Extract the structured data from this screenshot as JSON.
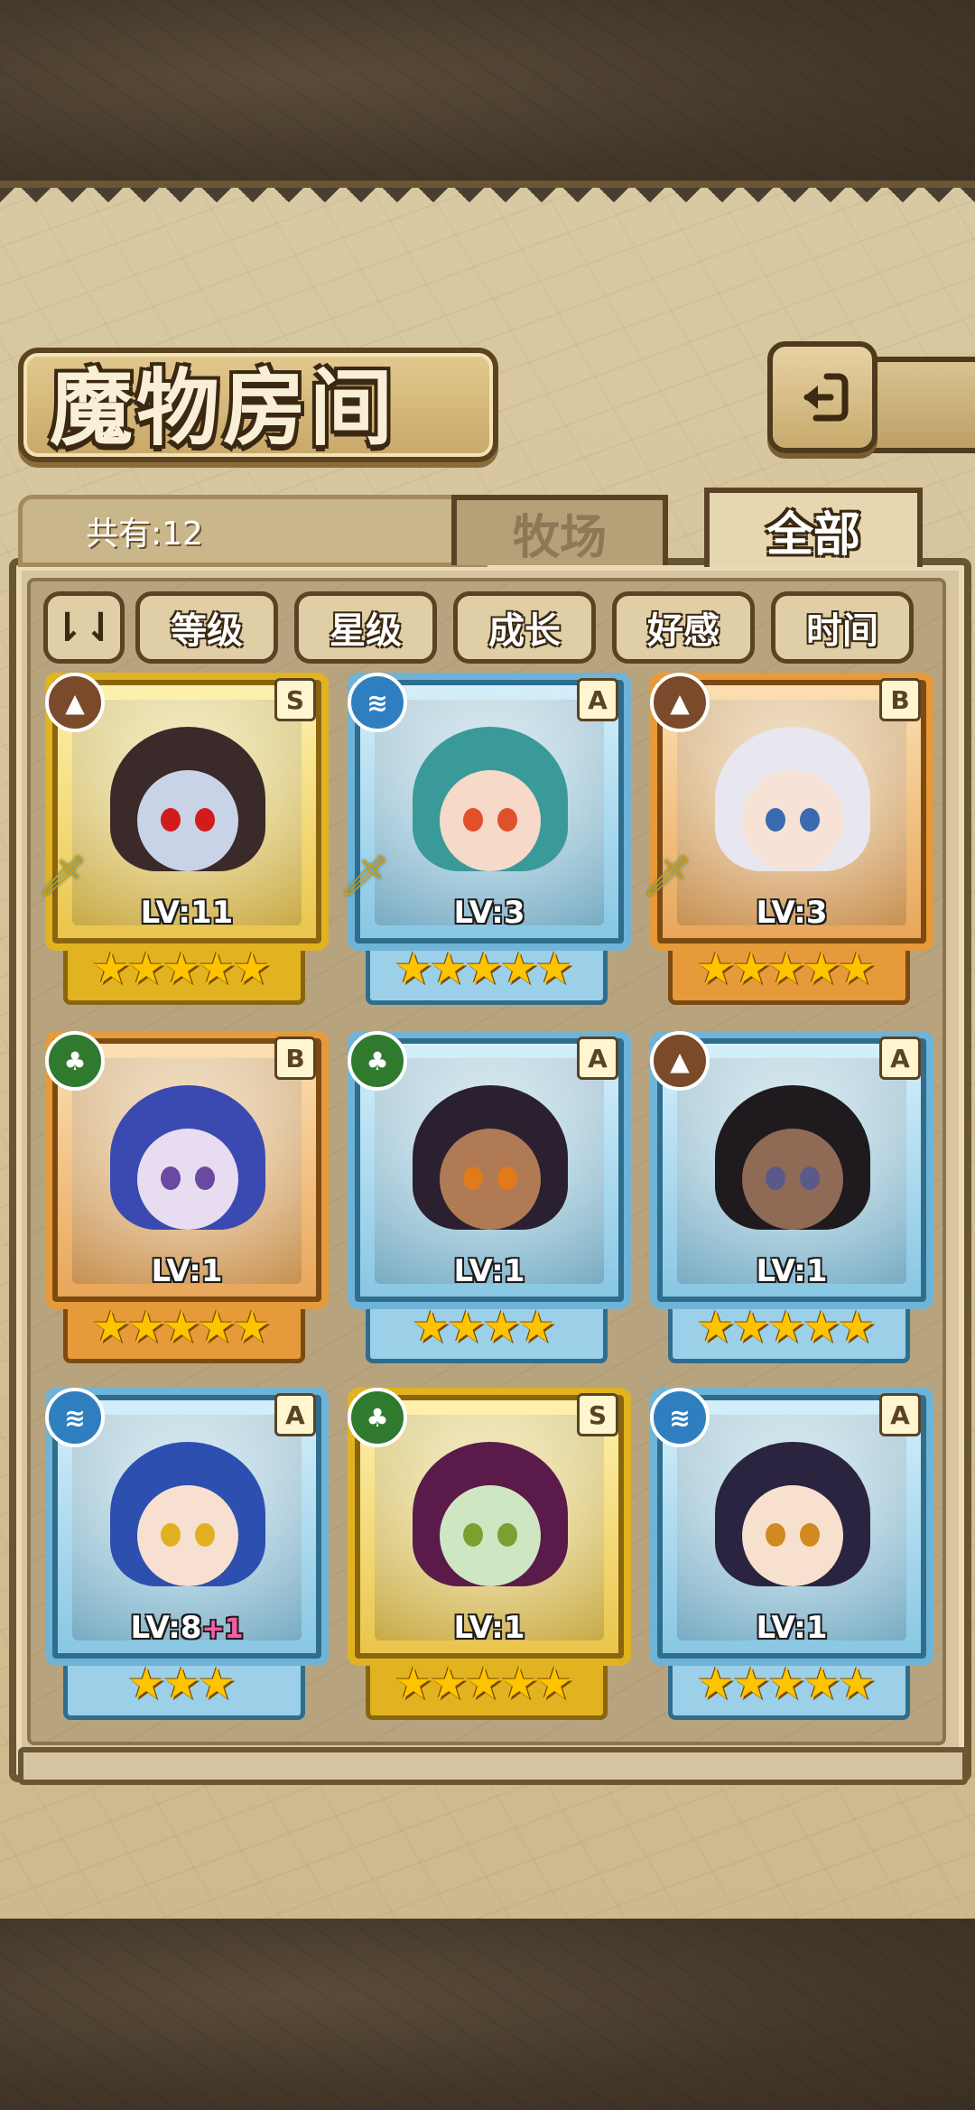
{
  "header": {
    "title": "魔物房间",
    "back_icon": "back-arrow-icon"
  },
  "summary": {
    "count_label": "共有:12"
  },
  "tabs": [
    {
      "label": "牧场",
      "active": false
    },
    {
      "label": "全部",
      "active": true
    }
  ],
  "filters": {
    "sort_toggle_icon": "sort-toggle-icon",
    "sort_toggle_label": "⇂⇃",
    "buttons": [
      "等级",
      "星级",
      "成长",
      "好感",
      "时间"
    ]
  },
  "monsters": [
    {
      "level": "LV:11",
      "rank": "S",
      "element": "earth",
      "frame": "gold",
      "stars": "★★★★★",
      "equipped": true,
      "bonus": ""
    },
    {
      "level": "LV:3",
      "rank": "A",
      "element": "water",
      "frame": "blue",
      "stars": "★★★★★",
      "equipped": true,
      "bonus": ""
    },
    {
      "level": "LV:3",
      "rank": "B",
      "element": "earth",
      "frame": "orange",
      "stars": "★★★★★",
      "equipped": true,
      "bonus": ""
    },
    {
      "level": "LV:1",
      "rank": "B",
      "element": "wood",
      "frame": "orange",
      "stars": "★★★★★",
      "equipped": false,
      "bonus": ""
    },
    {
      "level": "LV:1",
      "rank": "A",
      "element": "wood",
      "frame": "blue",
      "stars": "★★★★",
      "equipped": false,
      "bonus": ""
    },
    {
      "level": "LV:1",
      "rank": "A",
      "element": "earth",
      "frame": "blue",
      "stars": "★★★★★",
      "equipped": false,
      "bonus": ""
    },
    {
      "level": "LV:8",
      "rank": "A",
      "element": "water",
      "frame": "blue",
      "stars": "★★★",
      "equipped": false,
      "bonus": "+1"
    },
    {
      "level": "LV:1",
      "rank": "S",
      "element": "wood",
      "frame": "gold",
      "stars": "★★★★★",
      "equipped": false,
      "bonus": ""
    },
    {
      "level": "LV:1",
      "rank": "A",
      "element": "water",
      "frame": "blue",
      "stars": "★★★★★",
      "equipped": false,
      "bonus": ""
    }
  ],
  "colors": {
    "gold_frame": "#e1b320",
    "blue_frame": "#6fb3d6",
    "orange_frame": "#e69a3a",
    "panel_bg": "#d9c9a2"
  }
}
